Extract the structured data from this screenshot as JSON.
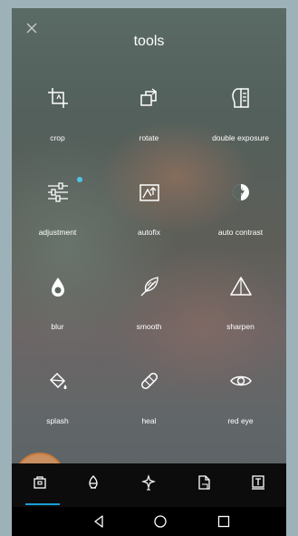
{
  "header": {
    "title": "tools"
  },
  "tools": [
    {
      "label": "crop"
    },
    {
      "label": "rotate"
    },
    {
      "label": "double exposure"
    },
    {
      "label": "adjustment"
    },
    {
      "label": "autofix"
    },
    {
      "label": "auto contrast"
    },
    {
      "label": "blur"
    },
    {
      "label": "smooth"
    },
    {
      "label": "sharpen"
    },
    {
      "label": "splash"
    },
    {
      "label": "heal"
    },
    {
      "label": "red eye"
    }
  ],
  "colors": {
    "accent": "#1a9fd6",
    "highlight": "#dc965f",
    "badge": "#4fc3e8"
  }
}
